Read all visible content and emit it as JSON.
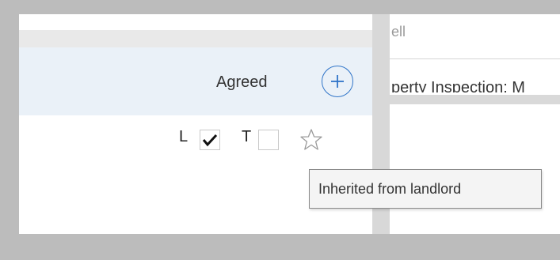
{
  "background_window": {
    "top_text": "ell",
    "mid_text": "perty Inspection: M"
  },
  "panel": {
    "header": {
      "agreed_label": "Agreed",
      "add_icon": "plus-circle-icon"
    },
    "row": {
      "landlord_label": "L",
      "landlord_checked": true,
      "tenant_label": "T",
      "tenant_checked": false,
      "star_icon": "star-outline-icon"
    }
  },
  "tooltip": {
    "text": "Inherited from landlord"
  },
  "colors": {
    "accent": "#2f74c8",
    "header_bg": "#eaf1f8",
    "frame_gray": "#bcbcbc"
  }
}
